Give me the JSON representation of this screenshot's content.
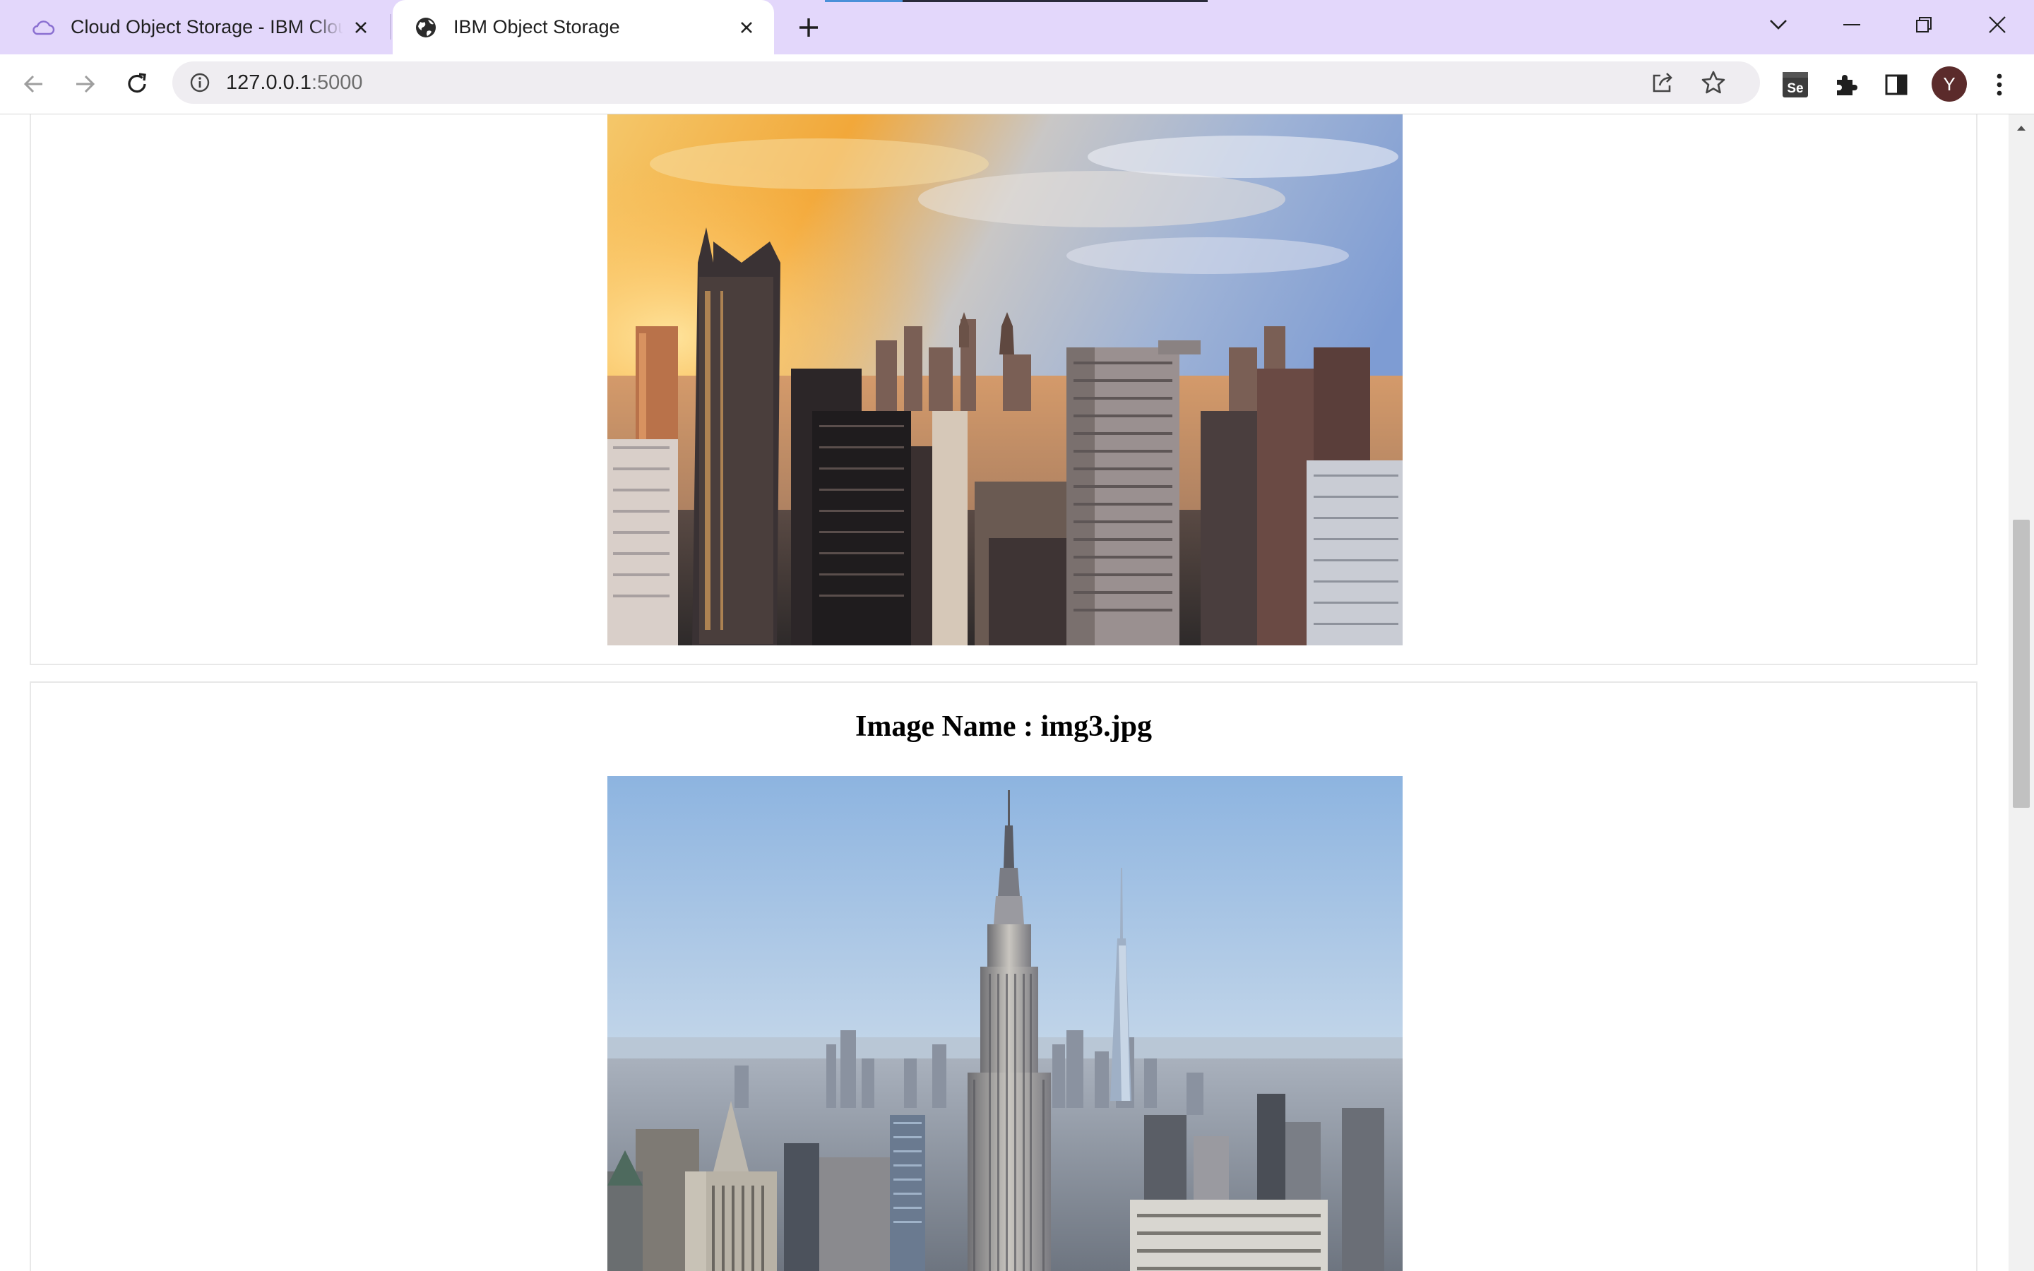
{
  "browser": {
    "tabs": [
      {
        "title": "Cloud Object Storage - IBM Cloud",
        "favicon": "cloud-icon",
        "active": false
      },
      {
        "title": "IBM Object Storage",
        "favicon": "globe-icon",
        "active": true
      }
    ],
    "url": {
      "host": "127.0.0.1",
      "port": ":5000"
    },
    "avatar_initial": "Y",
    "accent_color": "#e3d7fb"
  },
  "page": {
    "images": [
      {
        "name_label": "",
        "photo": "city-skyline-sunset"
      },
      {
        "name_label": "Image Name : img3.jpg",
        "photo": "empire-state-building-skyline"
      }
    ]
  }
}
